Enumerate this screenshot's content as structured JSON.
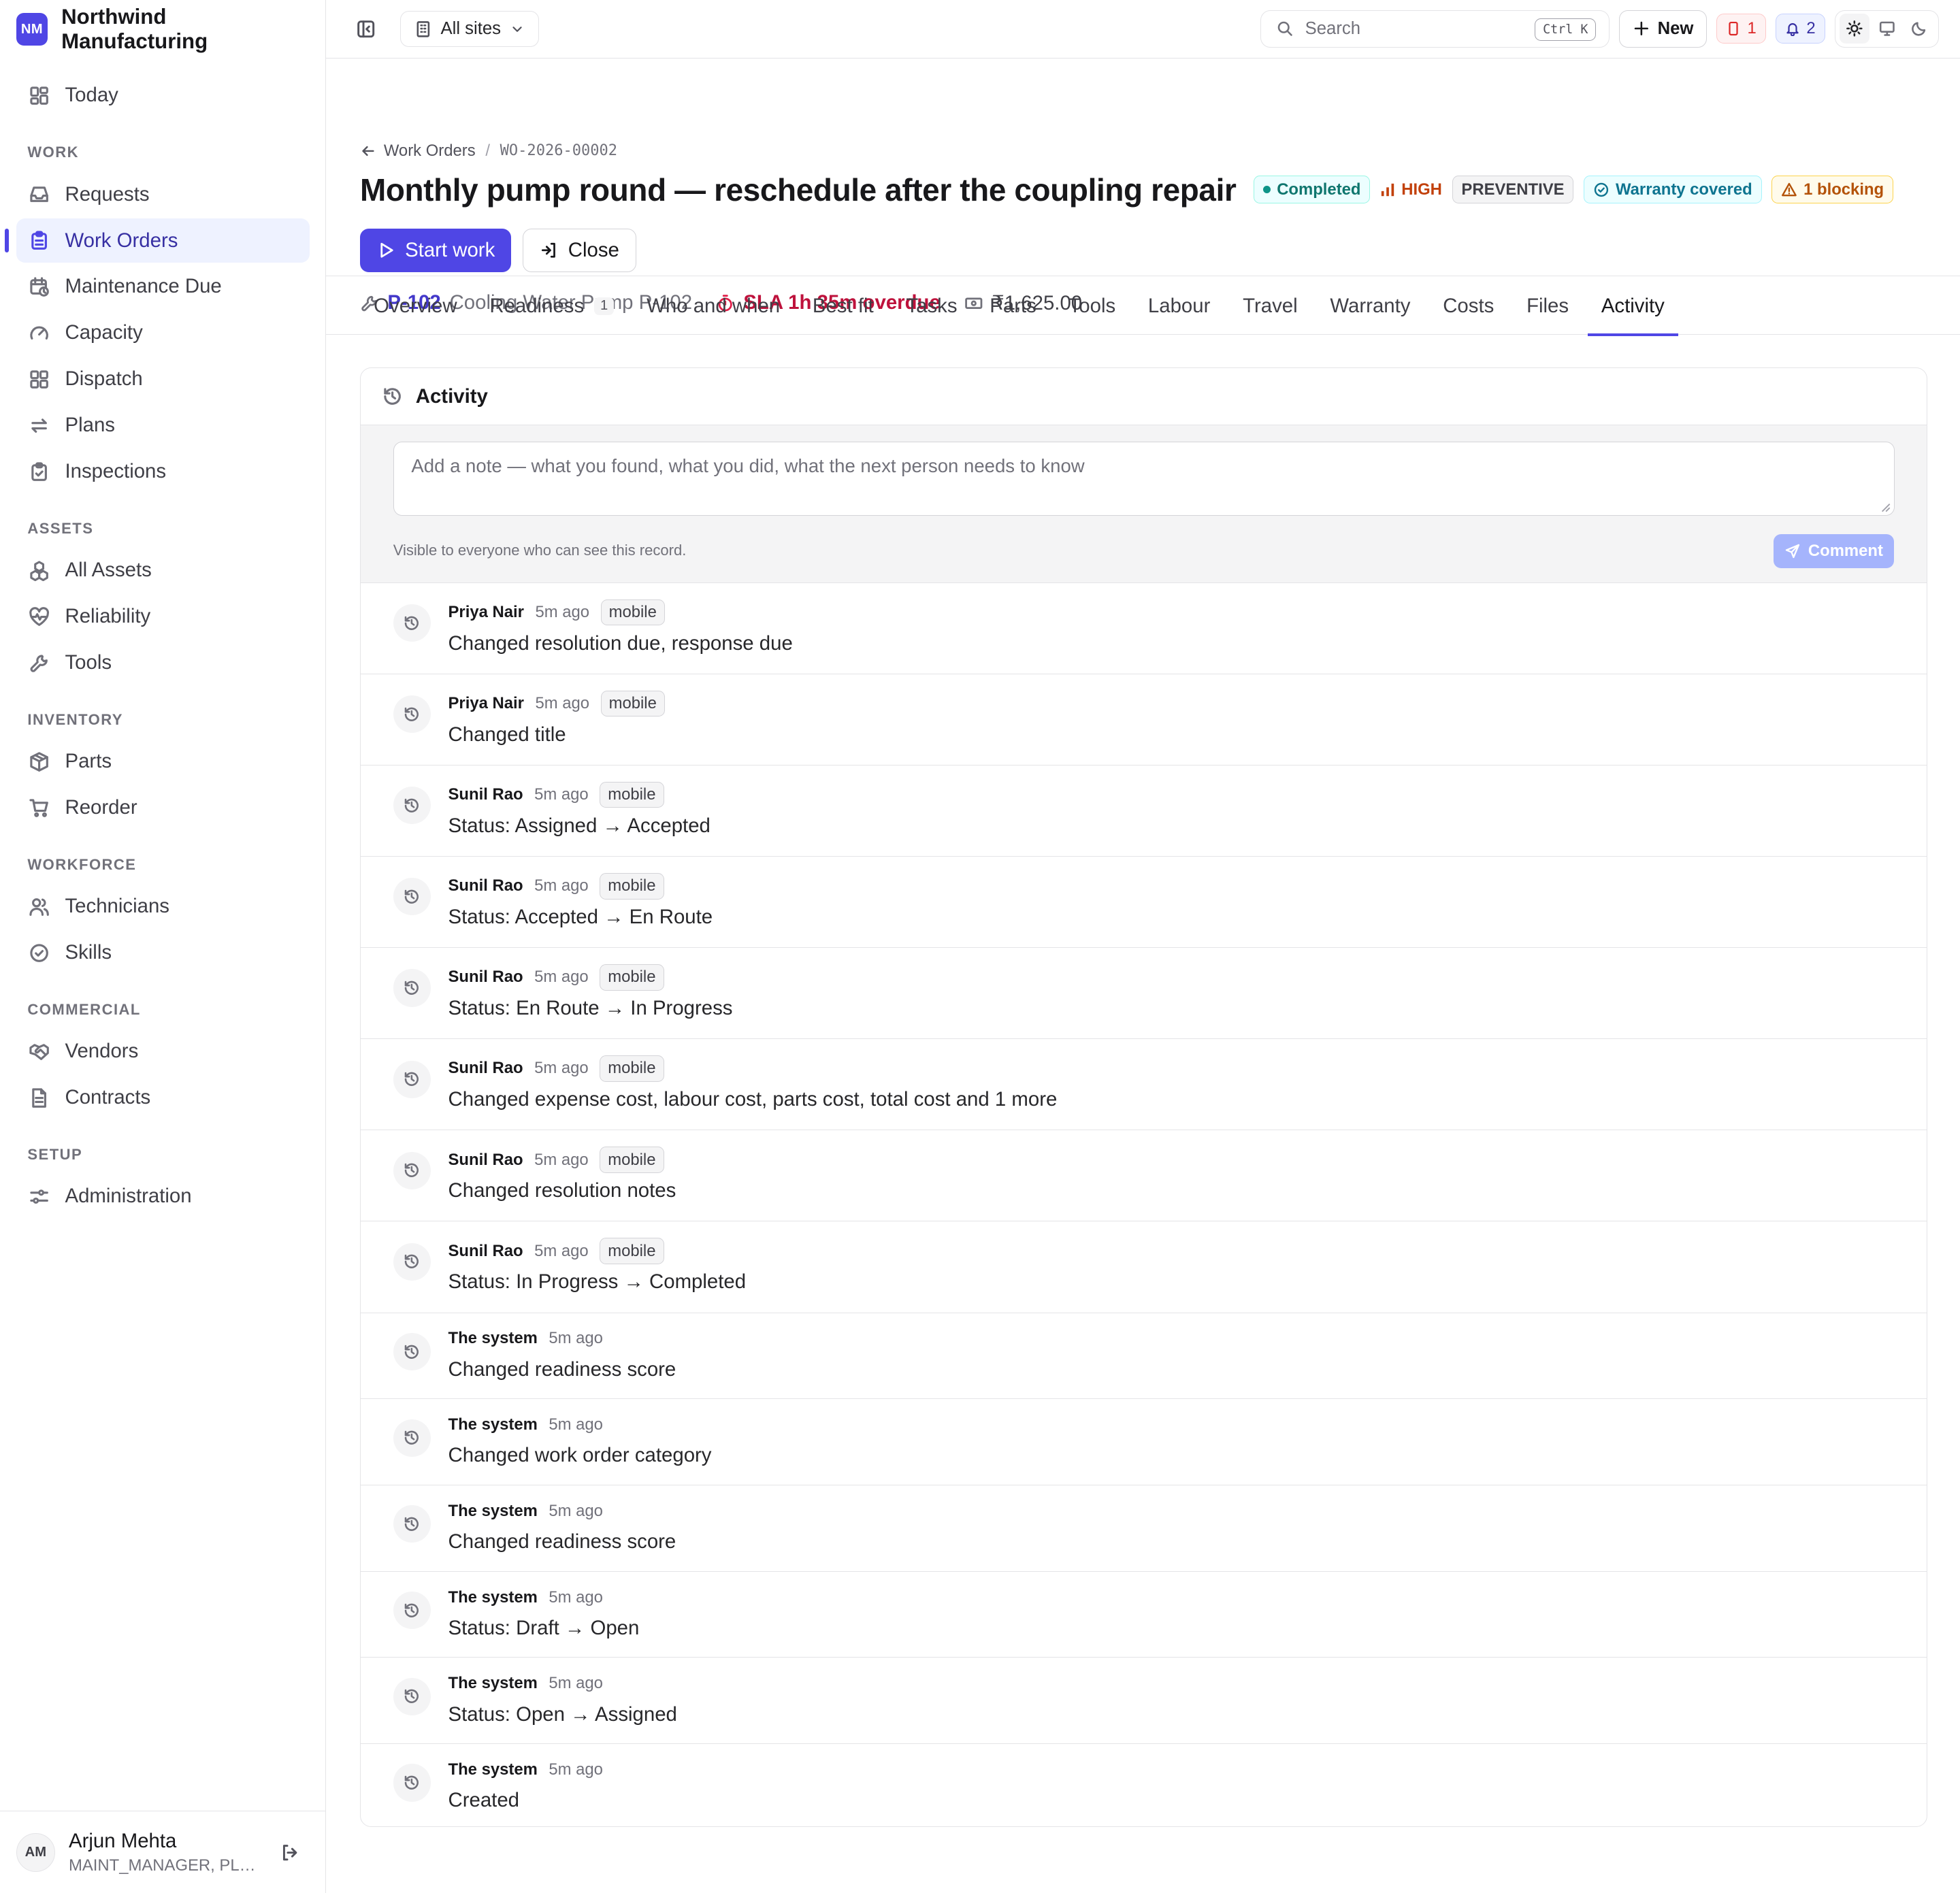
{
  "brand": {
    "initials": "NM",
    "name": "Northwind Manufacturing"
  },
  "nav": {
    "today": "Today",
    "sections": {
      "work": "WORK",
      "assets": "ASSETS",
      "inventory": "INVENTORY",
      "workforce": "WORKFORCE",
      "commercial": "COMMERCIAL",
      "setup": "SETUP"
    },
    "items": {
      "requests": "Requests",
      "work_orders": "Work Orders",
      "maintenance_due": "Maintenance Due",
      "capacity": "Capacity",
      "dispatch": "Dispatch",
      "plans": "Plans",
      "inspections": "Inspections",
      "all_assets": "All Assets",
      "reliability": "Reliability",
      "tools": "Tools",
      "parts": "Parts",
      "reorder": "Reorder",
      "technicians": "Technicians",
      "skills": "Skills",
      "vendors": "Vendors",
      "contracts": "Contracts",
      "administration": "Administration"
    },
    "active": "Work Orders"
  },
  "user": {
    "initials": "AM",
    "name": "Arjun Mehta",
    "role": "MAINT_MANAGER, PLANNER"
  },
  "topbar": {
    "sites": "All sites",
    "search_placeholder": "Search",
    "shortcut": "Ctrl K",
    "new_label": "New",
    "alert_count": "1",
    "notification_count": "2"
  },
  "work_order": {
    "breadcrumb_parent": "Work Orders",
    "breadcrumb_sep": "/",
    "number": "WO-2026-00002",
    "title": "Monthly pump round — reschedule after the coupling repair",
    "status": "Completed",
    "priority": "HIGH",
    "type": "PREVENTIVE",
    "warranty": "Warranty covered",
    "blocking": "1 blocking",
    "start_label": "Start work",
    "close_label": "Close",
    "asset_code": "P-102",
    "asset_name": "Cooling Water Pump P-102",
    "sla": "SLA 1h 35m overdue",
    "total_cost": "₹1,625.00",
    "colors": {
      "accent": "#4f46e5",
      "status": "#0d9488",
      "priority": "#c2410c",
      "sla": "#be123c"
    }
  },
  "tabs": [
    {
      "label": "Overview"
    },
    {
      "label": "Readiness",
      "count": "1"
    },
    {
      "label": "Who and when"
    },
    {
      "label": "Best fit"
    },
    {
      "label": "Tasks"
    },
    {
      "label": "Parts"
    },
    {
      "label": "Tools"
    },
    {
      "label": "Labour"
    },
    {
      "label": "Travel"
    },
    {
      "label": "Warranty"
    },
    {
      "label": "Costs"
    },
    {
      "label": "Files"
    },
    {
      "label": "Activity"
    }
  ],
  "activity": {
    "title": "Activity",
    "note_placeholder": "Add a note — what you found, what you did, what the next person needs to know",
    "visibility_hint": "Visible to everyone who can see this record.",
    "comment_label": "Comment",
    "events": [
      {
        "who": "Priya Nair",
        "when": "5m ago",
        "source": "mobile",
        "what": "Changed resolution due, response due"
      },
      {
        "who": "Priya Nair",
        "when": "5m ago",
        "source": "mobile",
        "what": "Changed title"
      },
      {
        "who": "Sunil Rao",
        "when": "5m ago",
        "source": "mobile",
        "what": "Status: Assigned → Accepted"
      },
      {
        "who": "Sunil Rao",
        "when": "5m ago",
        "source": "mobile",
        "what": "Status: Accepted → En Route"
      },
      {
        "who": "Sunil Rao",
        "when": "5m ago",
        "source": "mobile",
        "what": "Status: En Route → In Progress"
      },
      {
        "who": "Sunil Rao",
        "when": "5m ago",
        "source": "mobile",
        "what": "Changed expense cost, labour cost, parts cost, total cost and 1 more"
      },
      {
        "who": "Sunil Rao",
        "when": "5m ago",
        "source": "mobile",
        "what": "Changed resolution notes"
      },
      {
        "who": "Sunil Rao",
        "when": "5m ago",
        "source": "mobile",
        "what": "Status: In Progress → Completed"
      },
      {
        "who": "The system",
        "when": "5m ago",
        "what": "Changed readiness score"
      },
      {
        "who": "The system",
        "when": "5m ago",
        "what": "Changed work order category"
      },
      {
        "who": "The system",
        "when": "5m ago",
        "what": "Changed readiness score"
      },
      {
        "who": "The system",
        "when": "5m ago",
        "what": "Status: Draft → Open"
      },
      {
        "who": "The system",
        "when": "5m ago",
        "what": "Status: Open → Assigned"
      },
      {
        "who": "The system",
        "when": "5m ago",
        "what": "Created"
      }
    ]
  }
}
